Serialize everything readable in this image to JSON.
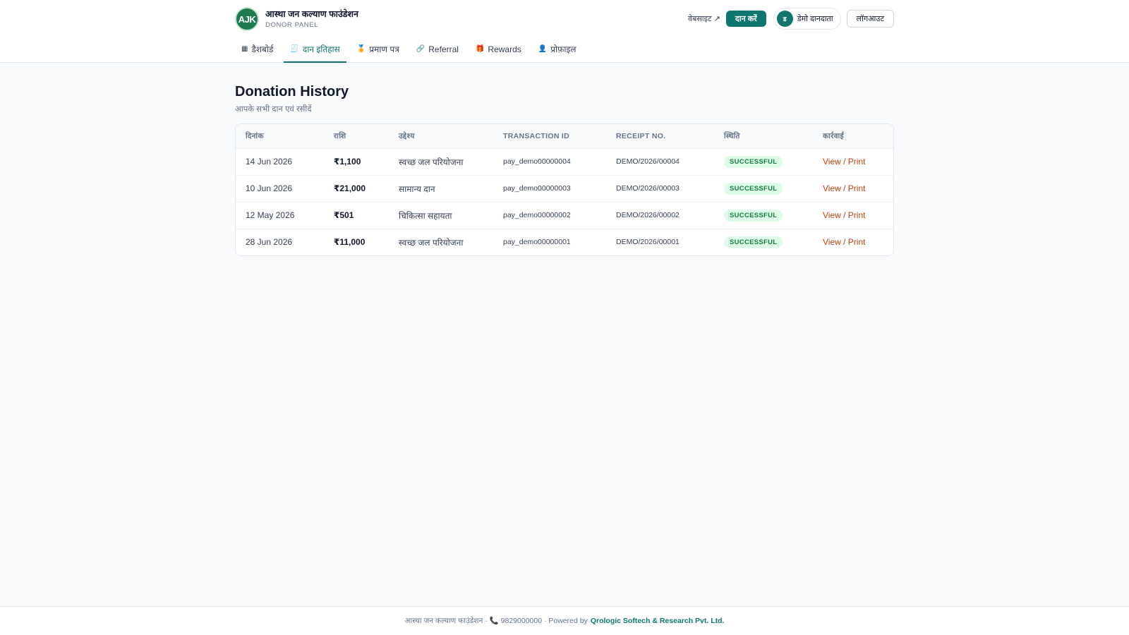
{
  "brand": {
    "logo_text": "AJK",
    "name": "आस्था जन कल्याण फाउंडेशन",
    "subtitle": "DONOR PANEL"
  },
  "header": {
    "website_link": "वेबसाइट ↗",
    "donate_button": "दान करें",
    "user_initial": "ड",
    "user_name": "डेमो दानदाता",
    "logout_button": "लॉगआउट"
  },
  "nav": {
    "tabs": [
      {
        "icon": "▦",
        "label": "डैशबोर्ड",
        "active": false
      },
      {
        "icon": "🧾",
        "label": "दान इतिहास",
        "active": true
      },
      {
        "icon": "🏅",
        "label": "प्रमाण पत्र",
        "active": false
      },
      {
        "icon": "🔗",
        "label": "Referral",
        "active": false
      },
      {
        "icon": "🎁",
        "label": "Rewards",
        "active": false
      },
      {
        "icon": "👤",
        "label": "प्रोफ़ाइल",
        "active": false
      }
    ]
  },
  "page": {
    "title": "Donation History",
    "subtitle": "आपके सभी दान एवं रसीदें"
  },
  "table": {
    "columns": [
      "दिनांक",
      "राशि",
      "उद्देश्य",
      "TRANSACTION ID",
      "RECEIPT NO.",
      "स्थिति",
      "कार्रवाई"
    ],
    "rows": [
      {
        "date": "14 Jun 2026",
        "amount": "₹1,100",
        "purpose": "स्वच्छ जल परियोजना",
        "txn": "pay_demo00000004",
        "receipt": "DEMO/2026/00004",
        "status": "SUCCESSFUL",
        "action": "View / Print"
      },
      {
        "date": "10 Jun 2026",
        "amount": "₹21,000",
        "purpose": "सामान्य दान",
        "txn": "pay_demo00000003",
        "receipt": "DEMO/2026/00003",
        "status": "SUCCESSFUL",
        "action": "View / Print"
      },
      {
        "date": "12 May 2026",
        "amount": "₹501",
        "purpose": "चिकित्सा सहायता",
        "txn": "pay_demo00000002",
        "receipt": "DEMO/2026/00002",
        "status": "SUCCESSFUL",
        "action": "View / Print"
      },
      {
        "date": "28 Jun 2026",
        "amount": "₹11,000",
        "purpose": "स्वच्छ जल परियोजना",
        "txn": "pay_demo00000001",
        "receipt": "DEMO/2026/00001",
        "status": "SUCCESSFUL",
        "action": "View / Print"
      }
    ]
  },
  "footer": {
    "text": "आस्था जन कल्याण फाउंडेशन · 📞 9829000000 · Powered by",
    "company": "Qrologic Softech & Research Pvt. Ltd."
  },
  "colors": {
    "accent": "#0f766e",
    "action_link": "#c2410c",
    "success_bg": "#dcfce7",
    "success_text": "#15803d"
  }
}
